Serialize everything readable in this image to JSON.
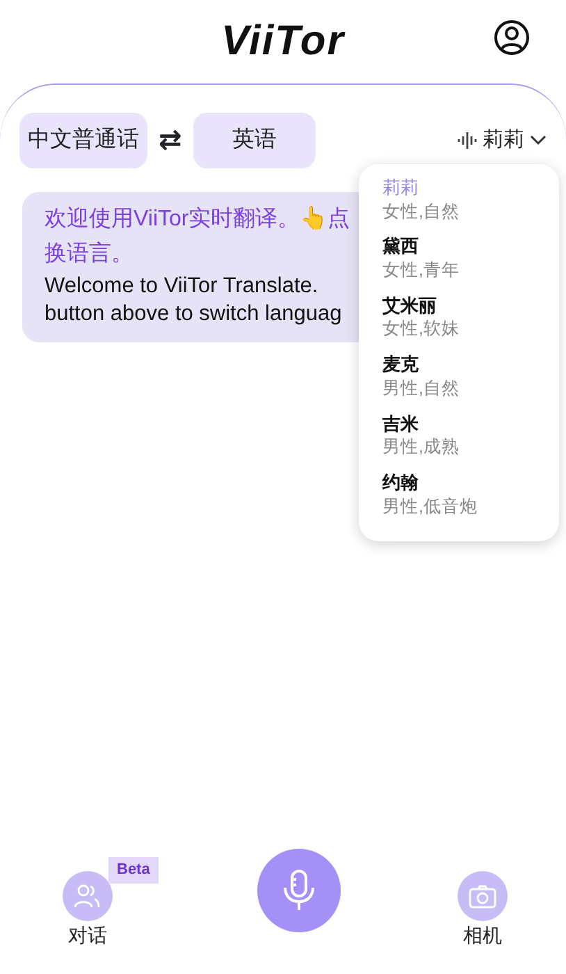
{
  "header": {
    "logo": "ViiTor"
  },
  "languages": {
    "source": "中文普通话",
    "swap": "⇄",
    "target": "英语"
  },
  "voice": {
    "current": "莉莉",
    "expanded": true
  },
  "message": {
    "lines": [
      "欢迎使用ViiTor实时翻译。👆点",
      "换语言。"
    ],
    "translation_lines": [
      "Welcome to ViiTor Translate.",
      "button above to switch languag"
    ]
  },
  "voice_menu": [
    {
      "name": "莉莉",
      "desc": "女性,自然",
      "selected": true
    },
    {
      "name": "黛西",
      "desc": "女性,青年",
      "selected": false
    },
    {
      "name": "艾米丽",
      "desc": "女性,软妹",
      "selected": false
    },
    {
      "name": "麦克",
      "desc": "男性,自然",
      "selected": false
    },
    {
      "name": "吉米",
      "desc": "男性,成熟",
      "selected": false
    },
    {
      "name": "约翰",
      "desc": "男性,低音炮",
      "selected": false
    }
  ],
  "bottom_bar": {
    "conversation": {
      "label": "对话",
      "badge": "Beta"
    },
    "camera": {
      "label": "相机"
    }
  }
}
